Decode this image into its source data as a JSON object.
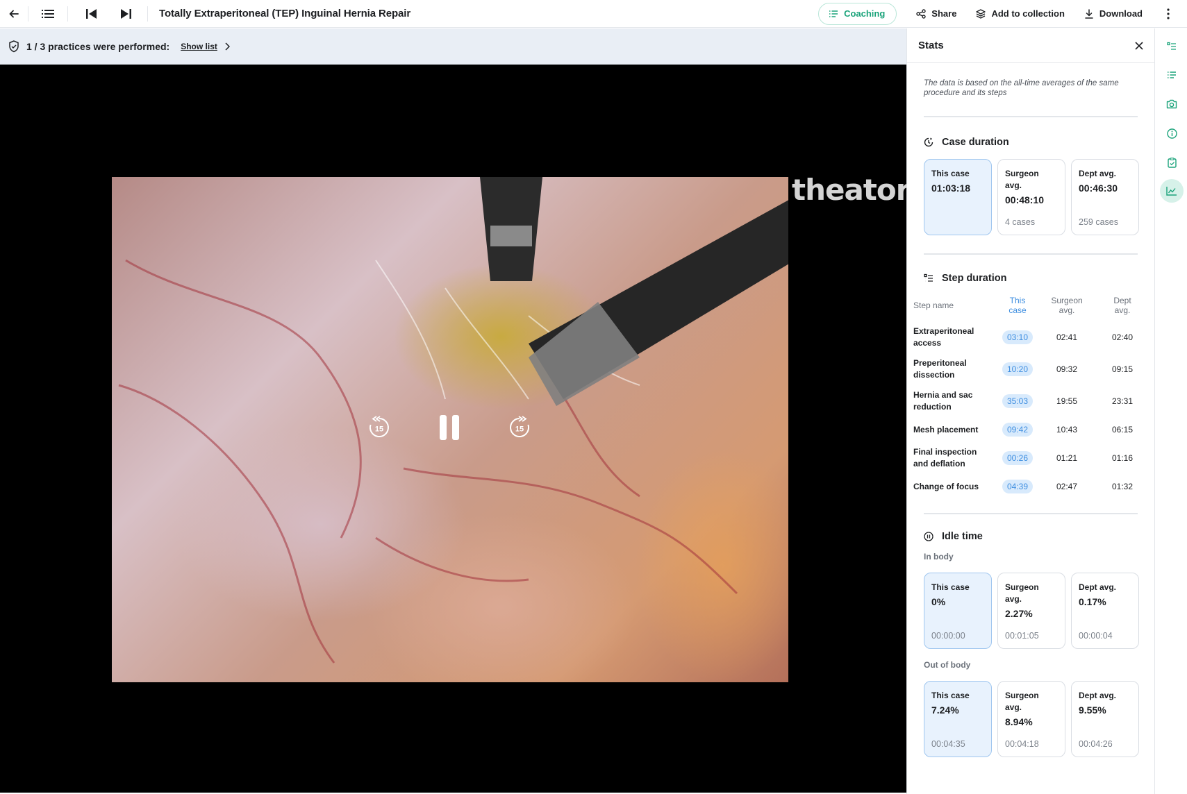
{
  "header": {
    "title": "Totally Extraperitoneal (TEP) Inguinal Hernia Repair",
    "coaching_label": "Coaching",
    "share_label": "Share",
    "collection_label": "Add to collection",
    "download_label": "Download"
  },
  "banner": {
    "text": "1 / 3 practices were performed:",
    "link": "Show list"
  },
  "video": {
    "watermark": "theator",
    "rewind_seconds": "15",
    "forward_seconds": "15"
  },
  "stats": {
    "title": "Stats",
    "note": "The data is based on the all-time averages of the same procedure and its steps",
    "case_duration": {
      "title": "Case duration",
      "this_case_label": "This case",
      "this_case_value": "01:03:18",
      "surgeon_label": "Surgeon avg.",
      "surgeon_value": "00:48:10",
      "surgeon_sub": "4 cases",
      "dept_label": "Dept avg.",
      "dept_value": "00:46:30",
      "dept_sub": "259 cases"
    },
    "step_duration": {
      "title": "Step duration",
      "headers": [
        "Step name",
        "This case",
        "Surgeon avg.",
        "Dept avg."
      ],
      "rows": [
        {
          "name": "Extraperitoneal access",
          "this": "03:10",
          "surgeon": "02:41",
          "dept": "02:40"
        },
        {
          "name": "Preperitoneal dissection",
          "this": "10:20",
          "surgeon": "09:32",
          "dept": "09:15"
        },
        {
          "name": "Hernia and sac reduction",
          "this": "35:03",
          "surgeon": "19:55",
          "dept": "23:31"
        },
        {
          "name": "Mesh placement",
          "this": "09:42",
          "surgeon": "10:43",
          "dept": "06:15"
        },
        {
          "name": "Final inspection and deflation",
          "this": "00:26",
          "surgeon": "01:21",
          "dept": "01:16"
        },
        {
          "name": "Change of focus",
          "this": "04:39",
          "surgeon": "02:47",
          "dept": "01:32"
        }
      ]
    },
    "idle_time": {
      "title": "Idle time",
      "in_body": {
        "label": "In body",
        "this_label": "This case",
        "this_value": "0%",
        "this_sub": "00:00:00",
        "surgeon_label": "Surgeon avg.",
        "surgeon_value": "2.27%",
        "surgeon_sub": "00:01:05",
        "dept_label": "Dept avg.",
        "dept_value": "0.17%",
        "dept_sub": "00:00:04"
      },
      "out_body": {
        "label": "Out of body",
        "this_label": "This case",
        "this_value": "7.24%",
        "this_sub": "00:04:35",
        "surgeon_label": "Surgeon avg.",
        "surgeon_value": "8.94%",
        "surgeon_sub": "00:04:18",
        "dept_label": "Dept avg.",
        "dept_value": "9.55%",
        "dept_sub": "00:04:26"
      }
    }
  },
  "colors": {
    "accent_green": "#1aa37a",
    "accent_blue": "#3e8ee0",
    "banner_bg": "#e9eef5"
  }
}
